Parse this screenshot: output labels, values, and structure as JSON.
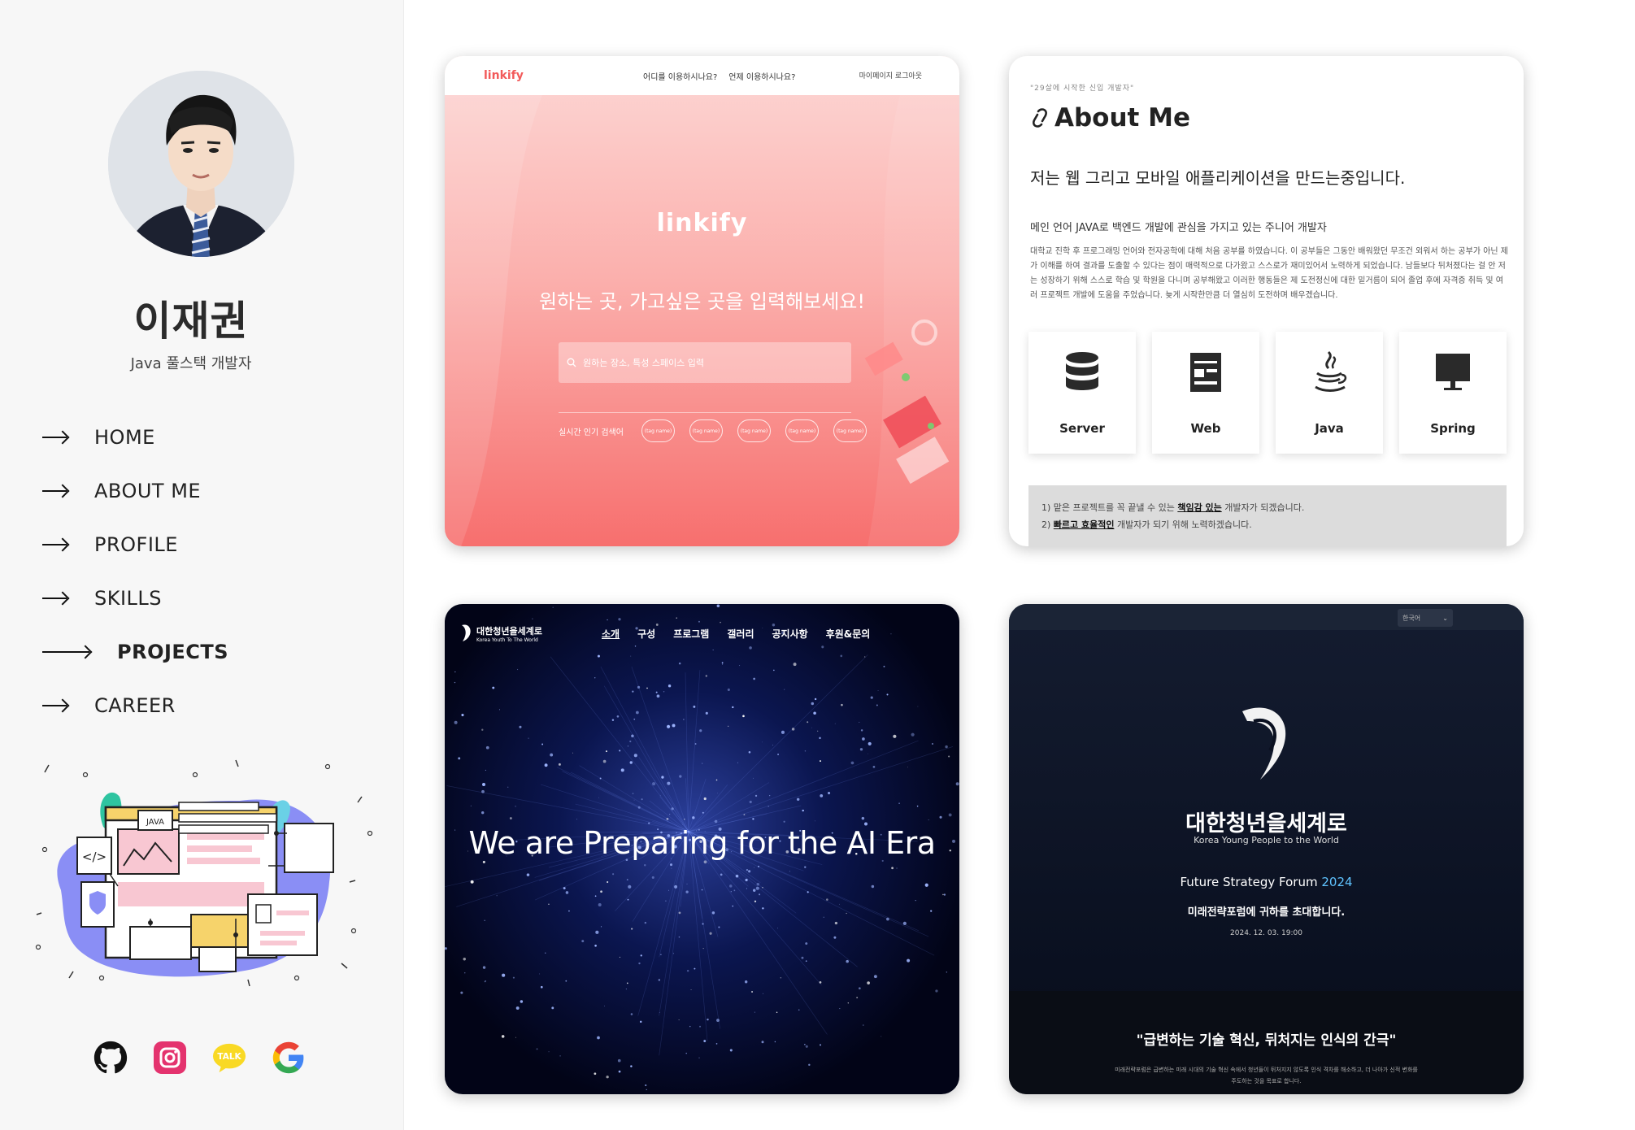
{
  "profile": {
    "name": "이재권",
    "subtitle": "Java 풀스택 개발자"
  },
  "nav": {
    "items": [
      {
        "label": "HOME"
      },
      {
        "label": "ABOUT ME"
      },
      {
        "label": "PROFILE"
      },
      {
        "label": "SKILLS"
      },
      {
        "label": "PROJECTS",
        "active": true
      },
      {
        "label": "CAREER"
      }
    ]
  },
  "illustration": {
    "java_label": "JAVA",
    "code_label": "</>"
  },
  "socials": {
    "talk_label": "TALK",
    "icons": [
      "github-icon",
      "instagram-icon",
      "kakaotalk-icon",
      "google-icon"
    ]
  },
  "projects": {
    "linkify": {
      "logo": "linkify",
      "nav_1": "어디를 이용하시나요?",
      "nav_2": "언제 이용하시나요?",
      "right": "마이페이지 로그아웃",
      "big_logo": "linkify",
      "headline": "원하는 곳, 가고싶은 곳을 입력해보세요!",
      "search_placeholder": "원하는 장소, 특성 스페이스 입력",
      "hot_label": "실시간 인기 검색어",
      "tags": [
        "(tag name)",
        "(tag name)",
        "(tag name)",
        "(tag name)",
        "(tag name)"
      ]
    },
    "about": {
      "small": "\"29살에 시작한 신입 개발자\"",
      "title": "About Me",
      "lead": "저는 웹 그리고 모바일 애플리케이션을 만드는중입니다.",
      "sub": "메인 언어 JAVA로 백엔드 개발에 관심을 가지고 있는 주니어 개발자",
      "para": "대학교 진학 후 프로그래밍 언어와 전자공학에 대해 처음 공부를 하였습니다. 이 공부들은 그동안 배워왔던 무조건 외워서 하는 공부가 아닌 제가 이해를 하여 결과를 도출할 수 있다는 점이 매력적으로 다가왔고 스스로가 재미있어서 노력하게 되었습니다. 남들보다 뒤처졌다는 걸 안 저는 성장하기 위해 스스로 학습 및 학원을 다니며 공부해왔고 이러한 행동들은 제 도전정신에 대한 밑거름이 되어 졸업 후에 자격증 취득 및 여러 프로젝트 개발에 도움을 주었습니다. 늦게 시작한만큼 더 열심히 도전하며 배우겠습니다.",
      "skills": [
        {
          "label": "Server",
          "icon": "database-icon"
        },
        {
          "label": "Web",
          "icon": "web-page-icon"
        },
        {
          "label": "Java",
          "icon": "java-icon"
        },
        {
          "label": "Spring",
          "icon": "monitor-icon"
        }
      ],
      "note1_pre": "1) 맡은 프로젝트를 꼭 끝낼 수 있는 ",
      "note1_em": "책임감 있는",
      "note1_post": " 개발자가 되겠습니다.",
      "note2_pre": "2) ",
      "note2_em": "빠르고 효율적인",
      "note2_post": " 개발자가 되기 위해 노력하겠습니다."
    },
    "ai": {
      "logo_ko": "대한청년을세계로",
      "logo_en": "Korea Youth To The World",
      "menu": [
        "소개",
        "구성",
        "프로그램",
        "갤러리",
        "공지사항",
        "후원&문의"
      ],
      "headline": "We are Preparing for the AI Era"
    },
    "forum": {
      "lang": "한국어",
      "title": "대한청년을세계로",
      "en": "Korea Young People to the World",
      "forum_text": "Future Strategy Forum",
      "year": "2024",
      "invite": "미래전략포럼에 귀하를 초대합니다.",
      "date": "2024. 12. 03. 19:00",
      "quote": "\"급변하는 기술 혁신, 뒤처지는 인식의 간극\"",
      "desc": "미래전략포럼은 급변하는 미래 시대의 기술 혁신 속에서 청년들이 뒤처지지 않도록 인식 격차를 해소하고, 더 나아가 신적 변화를 주도하는 것을 목표로 합니다."
    }
  },
  "colors": {
    "sidebar_bg": "#f7f7f7",
    "linkify_accent": "#f25a5a",
    "forum_year": "#5fc3ff"
  }
}
